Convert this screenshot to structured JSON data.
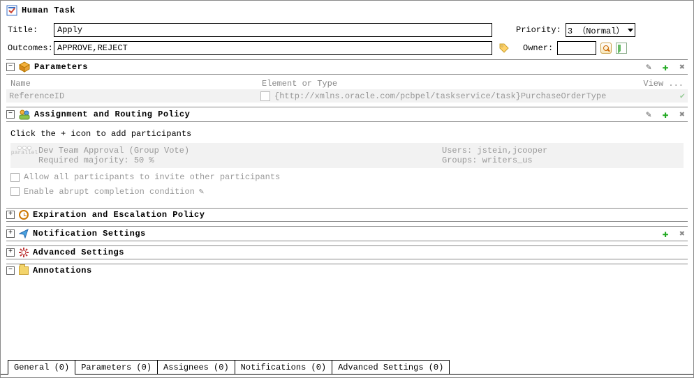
{
  "header": {
    "title": "Human Task"
  },
  "form": {
    "titleLabel": "Title:",
    "titleValue": "Apply",
    "outcomesLabel": "Outcomes:",
    "outcomesValue": "APPROVE,REJECT",
    "priorityLabel": "Priority:",
    "priorityValue": "3 （Normal）",
    "ownerLabel": "Owner:",
    "ownerValue": ""
  },
  "parameters": {
    "title": "Parameters",
    "columns": {
      "name": "Name",
      "type": "Element or Type",
      "view": "View ..."
    },
    "row": {
      "name": "ReferenceID",
      "type": "{http://xmlns.oracle.com/pcbpel/taskservice/task}PurchaseOrderType"
    }
  },
  "assignment": {
    "title": "Assignment and Routing Policy",
    "hint": "Click the + icon to add participants",
    "participant": {
      "line1": "Dev Team Approval (Group Vote)",
      "line2": "Required majority: 50 %",
      "usersLabel": "Users: ",
      "users": "jstein,jcooper",
      "groupsLabel": "Groups: ",
      "groups": "writers_us",
      "iconLabel": "parallel"
    },
    "chk1": "Allow all participants to invite other participants",
    "chk2": "Enable abrupt completion condition"
  },
  "expiration": {
    "title": "Expiration and Escalation Policy"
  },
  "notification": {
    "title": "Notification Settings"
  },
  "advanced": {
    "title": "Advanced Settings"
  },
  "annotations": {
    "title": "Annotations"
  },
  "tabs": [
    "General (0)",
    "Parameters (0)",
    "Assignees (0)",
    "Notifications (0)",
    "Advanced Settings (0)"
  ]
}
